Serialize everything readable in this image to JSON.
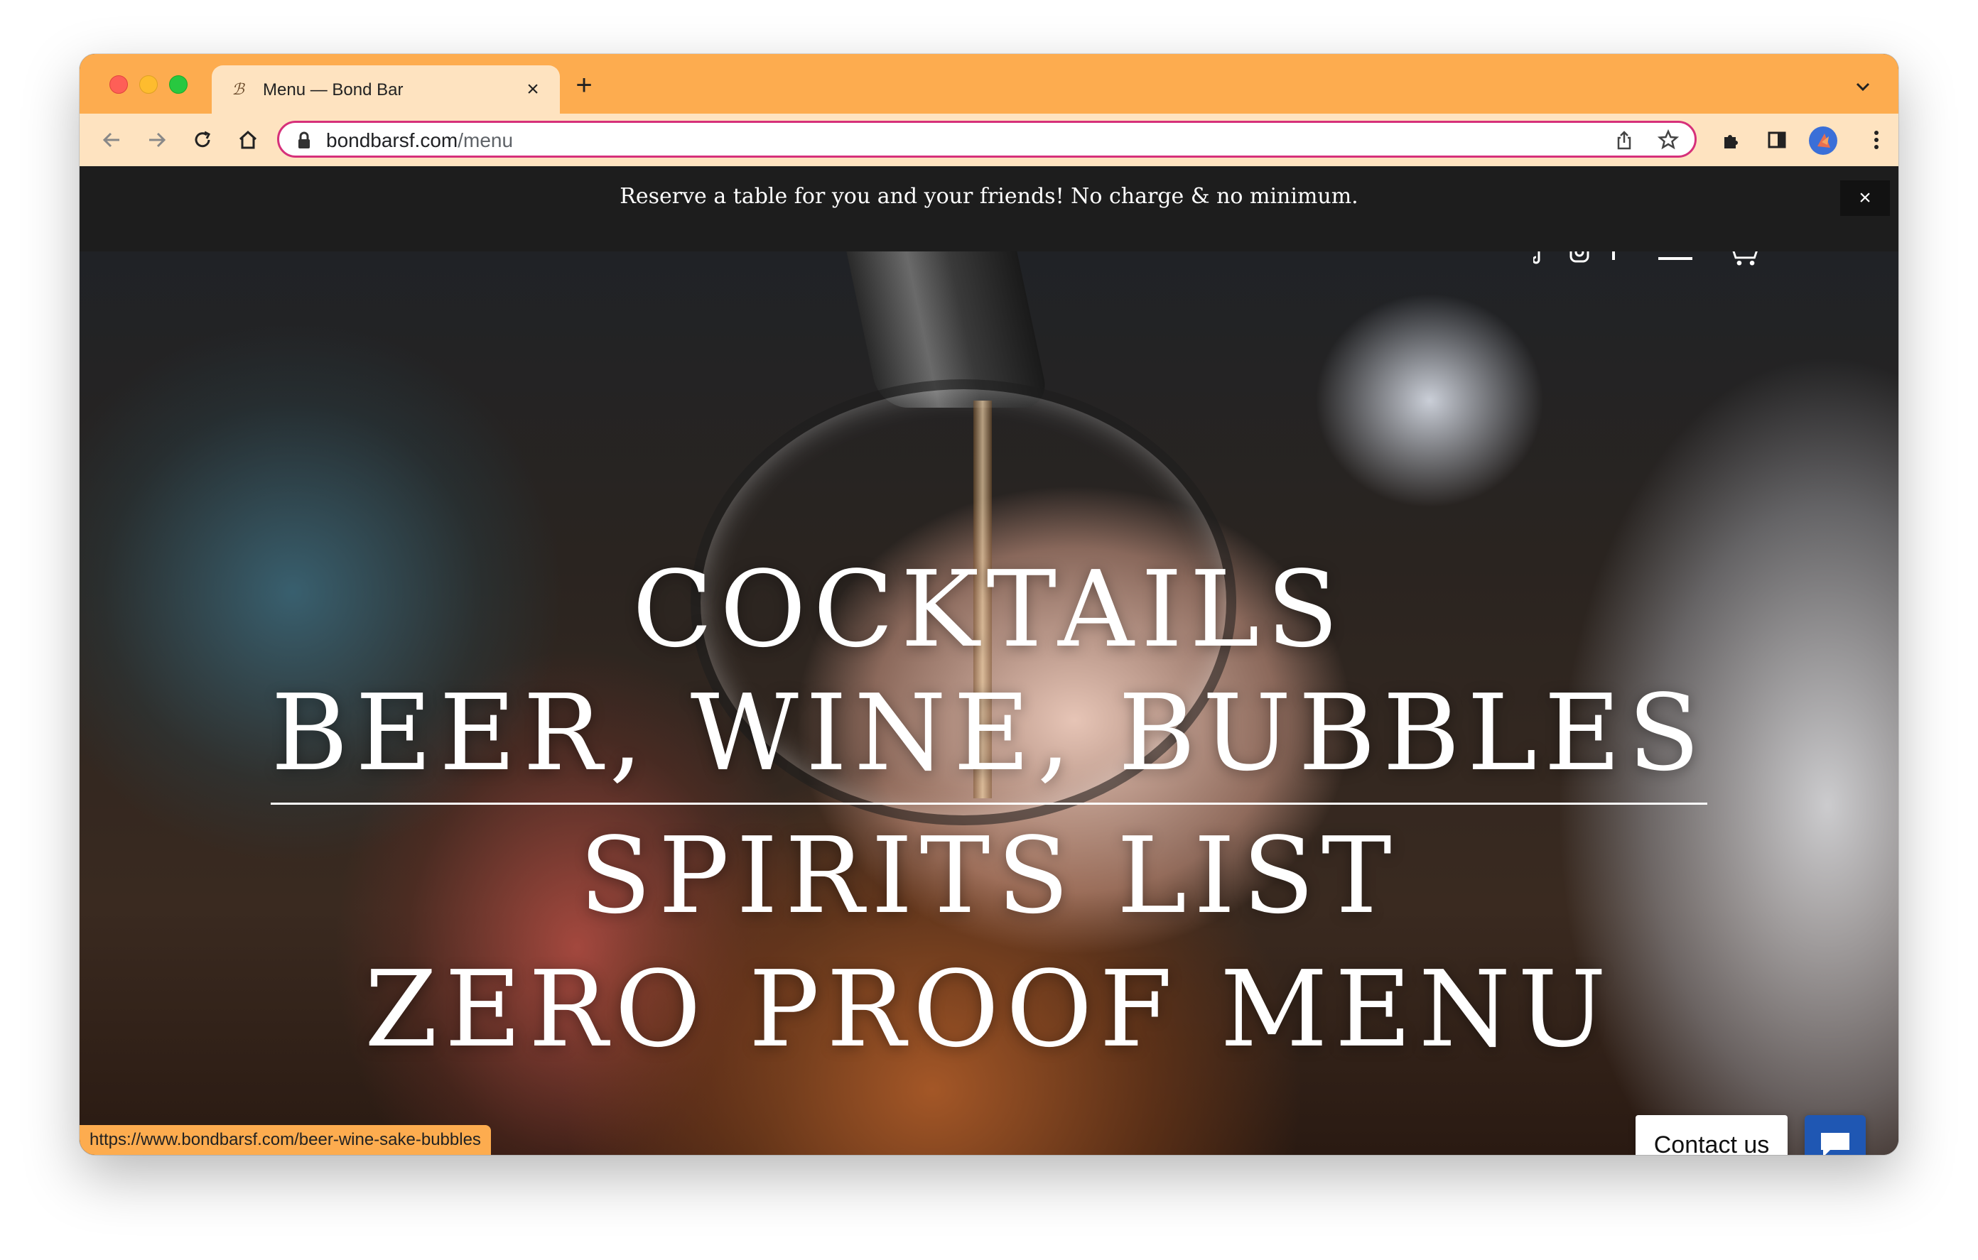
{
  "browser": {
    "tab": {
      "title": "Menu — Bond Bar",
      "favicon": "bond-bar-logo"
    },
    "toolbar": {
      "url_host": "bondbarsf.com",
      "url_path": "/menu"
    },
    "theme_color": "#fdac4f",
    "status_url": "https://www.bondbarsf.com/beer-wine-sake-bubbles"
  },
  "announcement": {
    "text": "Reserve a table for you and your friends! No charge & no minimum.",
    "close": "×"
  },
  "menu": {
    "links": [
      {
        "label": "COCKTAILS"
      },
      {
        "label": "BEER, WINE, BUBBLES",
        "hovered": true
      },
      {
        "label": "SPIRITS LIST"
      },
      {
        "label": "ZERO PROOF MENU"
      }
    ]
  },
  "chat": {
    "contact_label": "Contact us",
    "accent": "#1f57b3"
  }
}
